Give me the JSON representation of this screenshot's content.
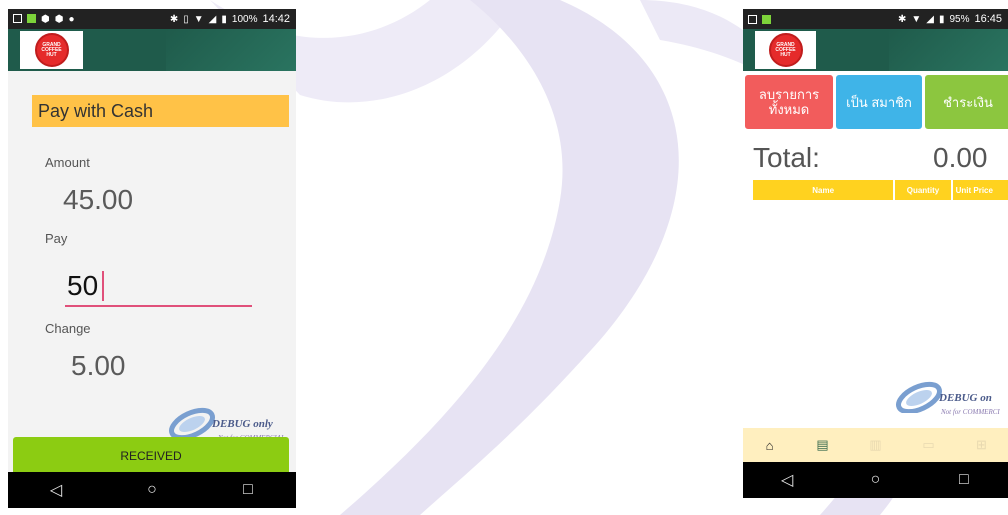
{
  "left_phone": {
    "status_time": "14:42",
    "status_battery": "100%",
    "logo_text": "GRAND COFFEE HUT",
    "pay_header": "Pay with Cash",
    "amount_label": "Amount",
    "amount_value": "45.00",
    "pay_label": "Pay",
    "pay_value": "50",
    "change_label": "Change",
    "change_value": "5.00",
    "received_button": "RECEIVED",
    "debug_text": "DEBUG only",
    "debug_subtext": "Not for COMMERCIAL",
    "nav": {
      "back": "◁",
      "home": "○",
      "recents": "□"
    }
  },
  "right_phone": {
    "status_time": "16:45",
    "status_battery": "95%",
    "logo_text": "GRAND COFFEE HUT",
    "buttons": {
      "clear_all": "ลบรายการ ทั้งหมด",
      "member": "เป็น สมาชิก",
      "pay": "ชำระเงิน"
    },
    "total_label": "Total:",
    "total_value": "0.00",
    "table_headers": {
      "name": "Name",
      "quantity": "Quantity",
      "unit_price": "Unit Price"
    },
    "debug_text": "DEBUG on",
    "debug_subtext": "Not for COMMERCI",
    "nav": {
      "back": "◁",
      "home": "○",
      "recents": "□"
    }
  },
  "colors": {
    "appbar": "#1f5b4b",
    "pay_header": "#ffc247",
    "received": "#8ccc12",
    "clear_btn": "#f25c5c",
    "member_btn": "#3fb4e8",
    "pay_btn": "#8cc63f",
    "table_header": "#ffd21f",
    "swoosh": "#e7e3f3"
  }
}
